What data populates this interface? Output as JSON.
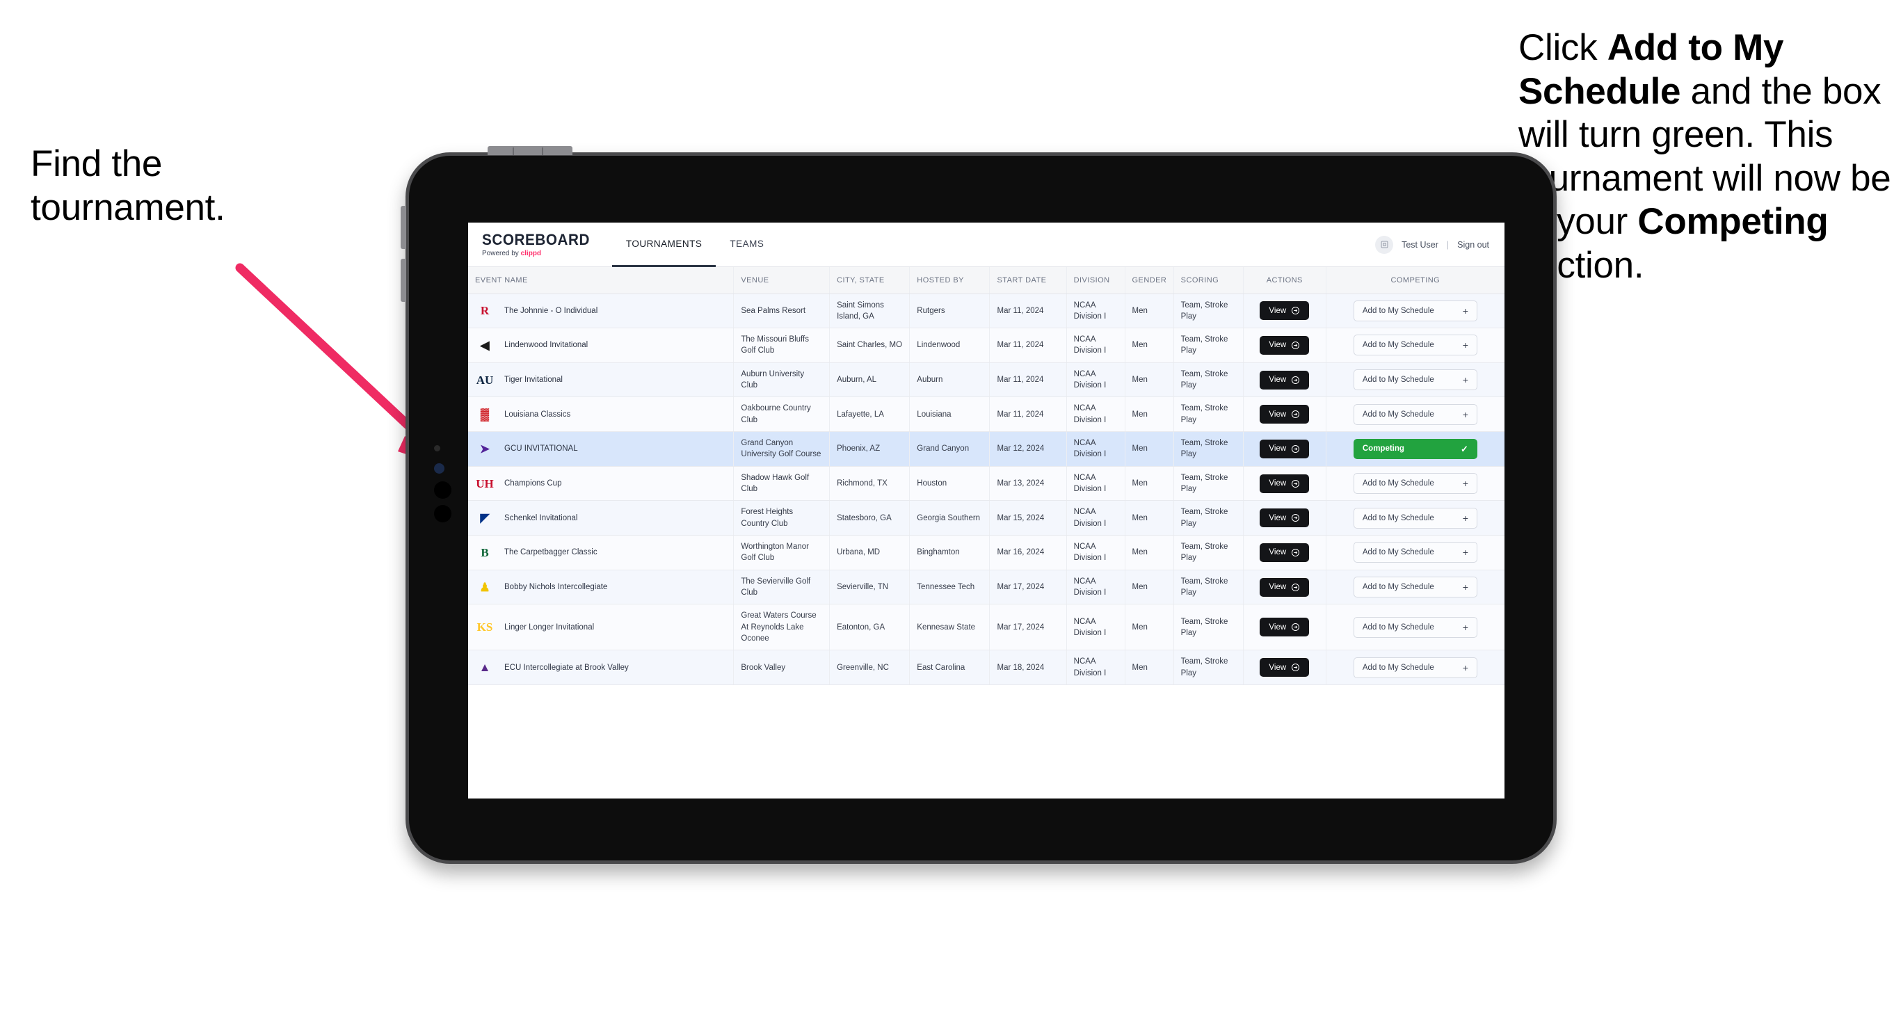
{
  "annotations": {
    "left": {
      "line1": "Find the",
      "line2": "tournament."
    },
    "right": {
      "seg1": "Click ",
      "bold1": "Add to My Schedule",
      "seg2": " and the box will turn green. This tournament will now be in your ",
      "bold2": "Competing",
      "seg3": " section."
    }
  },
  "app": {
    "brand": {
      "title": "SCOREBOARD",
      "powered_prefix": "Powered by ",
      "powered_name": "clippd"
    },
    "nav": [
      {
        "label": "TOURNAMENTS",
        "active": true
      },
      {
        "label": "TEAMS",
        "active": false
      }
    ],
    "user": {
      "name": "Test User",
      "separator": "|",
      "sign_out": "Sign out",
      "avatar_icon": "user-avatar-icon"
    },
    "table": {
      "columns": [
        "EVENT NAME",
        "VENUE",
        "CITY, STATE",
        "HOSTED BY",
        "START DATE",
        "DIVISION",
        "GENDER",
        "SCORING",
        "ACTIONS",
        "COMPETING"
      ],
      "view_label": "View",
      "add_label": "Add to My Schedule",
      "competing_label": "Competing",
      "rows": [
        {
          "event": "The Johnnie - O Individual",
          "logo_text": "R",
          "logo_color": "#c8102e",
          "venue": "Sea Palms Resort",
          "city": "Saint Simons Island, GA",
          "host": "Rutgers",
          "date": "Mar 11, 2024",
          "division": "NCAA Division I",
          "gender": "Men",
          "scoring": "Team, Stroke Play",
          "competing": false
        },
        {
          "event": "Lindenwood Invitational",
          "logo_text": "◀",
          "logo_color": "#1b1b1b",
          "venue": "The Missouri Bluffs Golf Club",
          "city": "Saint Charles, MO",
          "host": "Lindenwood",
          "date": "Mar 11, 2024",
          "division": "NCAA Division I",
          "gender": "Men",
          "scoring": "Team, Stroke Play",
          "competing": false
        },
        {
          "event": "Tiger Invitational",
          "logo_text": "AU",
          "logo_color": "#0c2340",
          "venue": "Auburn University Club",
          "city": "Auburn, AL",
          "host": "Auburn",
          "date": "Mar 11, 2024",
          "division": "NCAA Division I",
          "gender": "Men",
          "scoring": "Team, Stroke Play",
          "competing": false
        },
        {
          "event": "Louisiana Classics",
          "logo_text": "▓",
          "logo_color": "#ce181e",
          "venue": "Oakbourne Country Club",
          "city": "Lafayette, LA",
          "host": "Louisiana",
          "date": "Mar 11, 2024",
          "division": "NCAA Division I",
          "gender": "Men",
          "scoring": "Team, Stroke Play",
          "competing": false
        },
        {
          "event": "GCU INVITATIONAL",
          "logo_text": "➤",
          "logo_color": "#522398",
          "venue": "Grand Canyon University Golf Course",
          "city": "Phoenix, AZ",
          "host": "Grand Canyon",
          "date": "Mar 12, 2024",
          "division": "NCAA Division I",
          "gender": "Men",
          "scoring": "Team, Stroke Play",
          "competing": true
        },
        {
          "event": "Champions Cup",
          "logo_text": "UH",
          "logo_color": "#c8102e",
          "venue": "Shadow Hawk Golf Club",
          "city": "Richmond, TX",
          "host": "Houston",
          "date": "Mar 13, 2024",
          "division": "NCAA Division I",
          "gender": "Men",
          "scoring": "Team, Stroke Play",
          "competing": false
        },
        {
          "event": "Schenkel Invitational",
          "logo_text": "◤",
          "logo_color": "#003087",
          "venue": "Forest Heights Country Club",
          "city": "Statesboro, GA",
          "host": "Georgia Southern",
          "date": "Mar 15, 2024",
          "division": "NCAA Division I",
          "gender": "Men",
          "scoring": "Team, Stroke Play",
          "competing": false
        },
        {
          "event": "The Carpetbagger Classic",
          "logo_text": "B",
          "logo_color": "#0e6537",
          "venue": "Worthington Manor Golf Club",
          "city": "Urbana, MD",
          "host": "Binghamton",
          "date": "Mar 16, 2024",
          "division": "NCAA Division I",
          "gender": "Men",
          "scoring": "Team, Stroke Play",
          "competing": false
        },
        {
          "event": "Bobby Nichols Intercollegiate",
          "logo_text": "♟",
          "logo_color": "#f1c400",
          "venue": "The Sevierville Golf Club",
          "city": "Sevierville, TN",
          "host": "Tennessee Tech",
          "date": "Mar 17, 2024",
          "division": "NCAA Division I",
          "gender": "Men",
          "scoring": "Team, Stroke Play",
          "competing": false
        },
        {
          "event": "Linger Longer Invitational",
          "logo_text": "KS",
          "logo_color": "#ffc629",
          "venue": "Great Waters Course At Reynolds Lake Oconee",
          "city": "Eatonton, GA",
          "host": "Kennesaw State",
          "date": "Mar 17, 2024",
          "division": "NCAA Division I",
          "gender": "Men",
          "scoring": "Team, Stroke Play",
          "competing": false
        },
        {
          "event": "ECU Intercollegiate at Brook Valley",
          "logo_text": "▲",
          "logo_color": "#592a8a",
          "venue": "Brook Valley",
          "city": "Greenville, NC",
          "host": "East Carolina",
          "date": "Mar 18, 2024",
          "division": "NCAA Division I",
          "gender": "Men",
          "scoring": "Team, Stroke Play",
          "competing": false
        }
      ]
    }
  },
  "colors": {
    "accent_pink": "#ef2b63",
    "competing_green": "#22a33f",
    "selected_row_blue": "#d8e6fb",
    "clippd_pink": "#ff2d6a"
  }
}
